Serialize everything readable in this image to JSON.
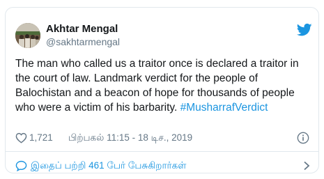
{
  "author": {
    "display_name": "Akhtar Mengal",
    "handle": "@sakhtarmengal"
  },
  "tweet": {
    "text": "The man who called us a traitor once  is declared a traitor in the court of law. Landmark verdict for the people of Balochistan and a beacon of hope for thousands of people who were a victim of his barbarity. ",
    "hashtag": "#MusharrafVerdict"
  },
  "meta": {
    "like_count": "1,721",
    "timestamp": "பிற்பகல் 11:15 - 18 டிச., 2019"
  },
  "replies": {
    "label": "இதைப் பற்றி 461 பேர் பேசுகிறார்கள்"
  },
  "icons": {
    "brand": "twitter-bird-icon",
    "like": "heart-icon",
    "info": "info-icon",
    "reply": "speech-bubble-icon",
    "more": "chevron-right-icon"
  },
  "colors": {
    "brand_blue": "#1b95e0",
    "text_primary": "#14171a",
    "text_secondary": "#657786",
    "border": "#e1e8ed"
  }
}
